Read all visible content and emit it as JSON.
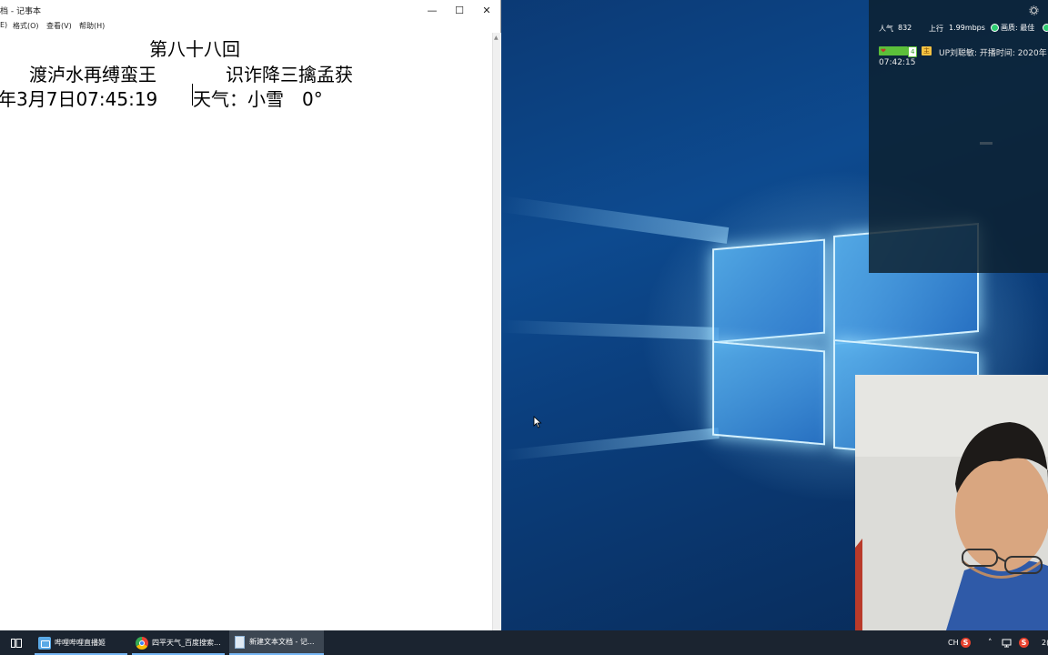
{
  "notepad": {
    "title": "档 - 记事本",
    "menu": [
      "E)",
      "格式(O)",
      "查看(V)",
      "帮助(H)"
    ],
    "window_buttons": {
      "minimize": "—",
      "maximize": "☐",
      "close": "✕"
    },
    "lines": {
      "chapter": "第八十八回",
      "heading_left": "渡泸水再缚蛮王",
      "heading_right": "识诈降三擒孟获",
      "date": "年3月7日07:45:19",
      "weather": "天气：小雪　0°"
    }
  },
  "stream_overlay": {
    "popularity_label": "人气",
    "popularity_value": "832",
    "upload_label": "上行",
    "upload_value": "1.99mbps",
    "quality_label": "画质: 最佳",
    "badge_level": "4",
    "badge_host": "主",
    "up_name_text": "UP刘聪敏: 开播时间: 2020年",
    "start_time": "07:42:15"
  },
  "taskbar": {
    "apps": [
      {
        "label": "哔哩哔哩直播姬",
        "icon": "bilibili-live-icon"
      },
      {
        "label": "四平天气_百度搜索...",
        "icon": "chrome-icon"
      },
      {
        "label": "新建文本文档 - 记...",
        "icon": "notepad-icon"
      }
    ],
    "tray": {
      "ime": "CH",
      "clock": "2("
    }
  },
  "colors": {
    "wallpaper_blue": "#0d4a8f",
    "taskbar": "#1b2430",
    "accent": "#77b7f5",
    "status_green": "#2ecc71"
  }
}
